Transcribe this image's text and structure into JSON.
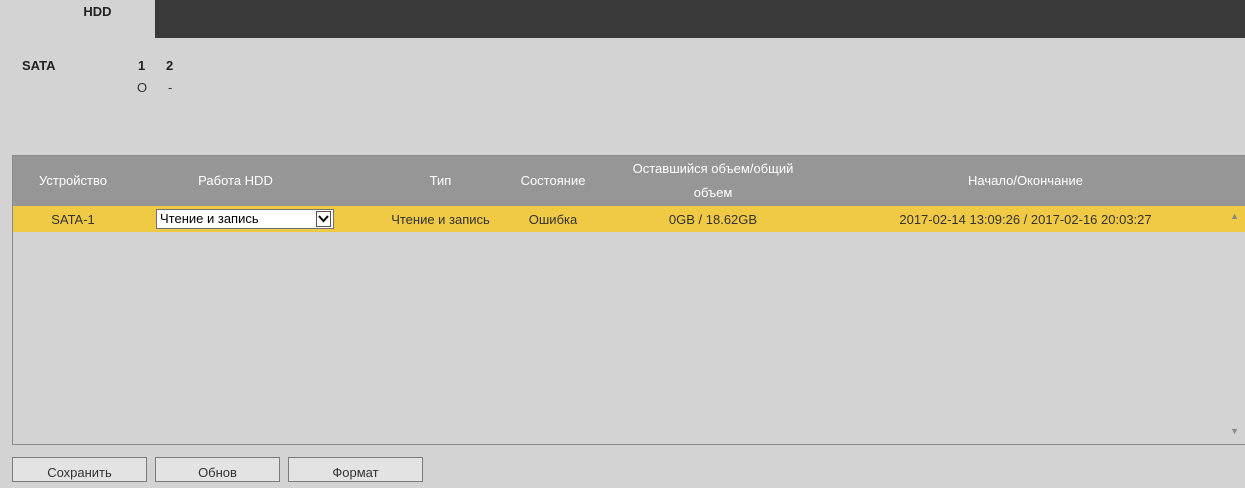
{
  "tabs": {
    "active": "HDD"
  },
  "sata": {
    "label": "SATA",
    "disks": [
      {
        "num": "1",
        "state": "O"
      },
      {
        "num": "2",
        "state": "-"
      }
    ]
  },
  "table": {
    "headers": {
      "device": "Устройство",
      "operation": "Работа HDD",
      "type": "Тип",
      "status": "Состояние",
      "space_line1": "Оставшийся объем/общий",
      "space_line2": "объем",
      "range": "Начало/Окончание"
    },
    "rows": [
      {
        "device": "SATA-1",
        "operation": "Чтение и запись",
        "type": "Чтение и запись",
        "status": "Ошибка",
        "space": "0GB / 18.62GB",
        "range": "2017-02-14 13:09:26 / 2017-02-16 20:03:27"
      }
    ],
    "row_color": "#f0c945"
  },
  "buttons": {
    "save": "Сохранить",
    "refresh": "Обнов",
    "format": "Формат"
  }
}
